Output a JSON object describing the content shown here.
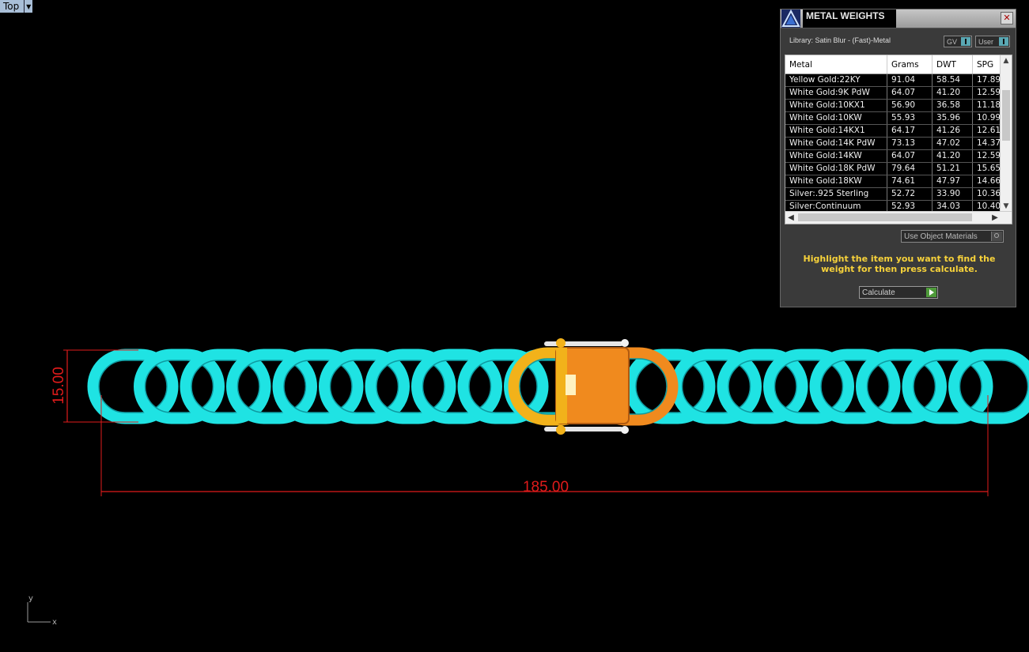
{
  "viewport": {
    "name": "Top",
    "dim_width": "185.00",
    "dim_height": "15.00",
    "axis_y": "y",
    "axis_x": "x",
    "colors": {
      "chain": "#1fe3e3",
      "clasp": "#f08a1e",
      "gold": "#f2b21a",
      "dimension": "#e01b1b"
    }
  },
  "panel": {
    "title": "METAL WEIGHTS",
    "close_icon": "close-icon",
    "library": "Library: Satin Blur - (Fast)-Metal",
    "toggle_gv": "GV",
    "toggle_user": "User",
    "columns": [
      "Metal",
      "Grams",
      "DWT",
      "SPG"
    ],
    "rows": [
      [
        "Yellow Gold:22KY",
        "91.04",
        "58.54",
        "17.89"
      ],
      [
        "White Gold:9K PdW",
        "64.07",
        "41.20",
        "12.59"
      ],
      [
        "White Gold:10KX1",
        "56.90",
        "36.58",
        "11.18"
      ],
      [
        "White Gold:10KW",
        "55.93",
        "35.96",
        "10.99"
      ],
      [
        "White Gold:14KX1",
        "64.17",
        "41.26",
        "12.61"
      ],
      [
        "White Gold:14K PdW",
        "73.13",
        "47.02",
        "14.37"
      ],
      [
        "White Gold:14KW",
        "64.07",
        "41.20",
        "12.59"
      ],
      [
        "White Gold:18K PdW",
        "79.64",
        "51.21",
        "15.65"
      ],
      [
        "White Gold:18KW",
        "74.61",
        "47.97",
        "14.66"
      ],
      [
        "Silver:.925 Sterling",
        "52.72",
        "33.90",
        "10.36"
      ],
      [
        "Silver:Continuum",
        "52.93",
        "34.03",
        "10.40"
      ]
    ],
    "use_object_materials": "Use Object Materials",
    "hint": "Highlight the item you want to find the weight for then press calculate.",
    "calculate": "Calculate"
  }
}
